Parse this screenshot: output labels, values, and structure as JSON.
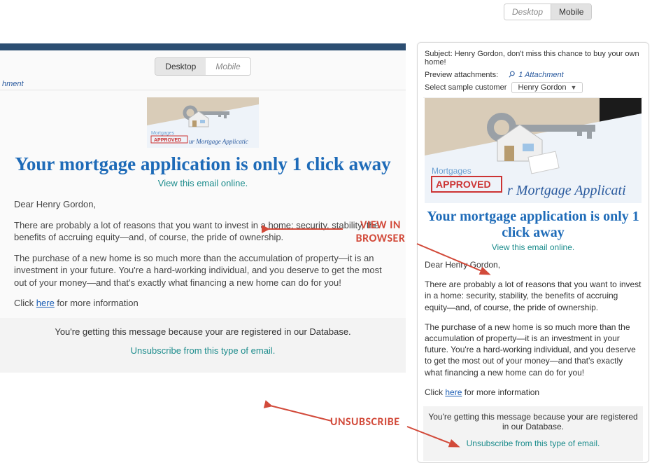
{
  "global_toggle": {
    "desktop": "Desktop",
    "mobile": "Mobile"
  },
  "desk_toggle": {
    "desktop": "Desktop",
    "mobile": "Mobile"
  },
  "left": {
    "attachment_label": "hment",
    "headline": "Your mortgage application is only 1 click away",
    "view_online": "View this email online.",
    "greeting": "Dear Henry Gordon,",
    "para1": "There are probably a lot of reasons that you want to invest in a home: security, stability, the benefits of accruing equity—and, of course, the pride of ownership.",
    "para2": "The purchase of a new home is so much more than the accumulation of property—it is an investment in your future. You're a hard-working individual, and you deserve to get the most out of your money—and that's exactly what financing a new home can do for you!",
    "click_pre": "Click ",
    "click_link": "here",
    "click_post": " for more information",
    "footer_text": "You're getting this message because your are registered in our Database.",
    "unsubscribe": "Unsubscribe from this type of email."
  },
  "right": {
    "subject_label": "Subject:",
    "subject_value": "Henry Gordon, don't miss this chance to buy your own home!",
    "preview_label": "Preview attachments:",
    "attachment_link": "1 Attachment",
    "select_label": "Select sample customer",
    "selected_customer": "Henry Gordon",
    "headline": "Your mortgage application is only 1 click away",
    "view_online": "View this email online.",
    "greeting": "Dear Henry Gordon,",
    "para1": "There are probably a lot of reasons that you want to invest in a home: security, stability, the benefits of accruing equity—and, of course, the pride of ownership.",
    "para2": "The purchase of a new home is so much more than the accumulation of property—it is an investment in your future. You're a hard-working individual, and you deserve to get the most out of your money—and that's exactly what financing a new home can do for you!",
    "click_pre": "Click ",
    "click_link": "here",
    "click_post": " for more information",
    "footer_text": "You're getting this message because your are registered in our Database.",
    "unsubscribe": "Unsubscribe from this type of email."
  },
  "annotations": {
    "view_in_browser_l1": "VIEW IN",
    "view_in_browser_l2": "BROWSER",
    "unsubscribe": "UNSUBSCRIBE"
  },
  "colors": {
    "accent_blue": "#1e6bb8",
    "accent_teal": "#1c8c8c",
    "annot_red": "#d24a3a"
  }
}
